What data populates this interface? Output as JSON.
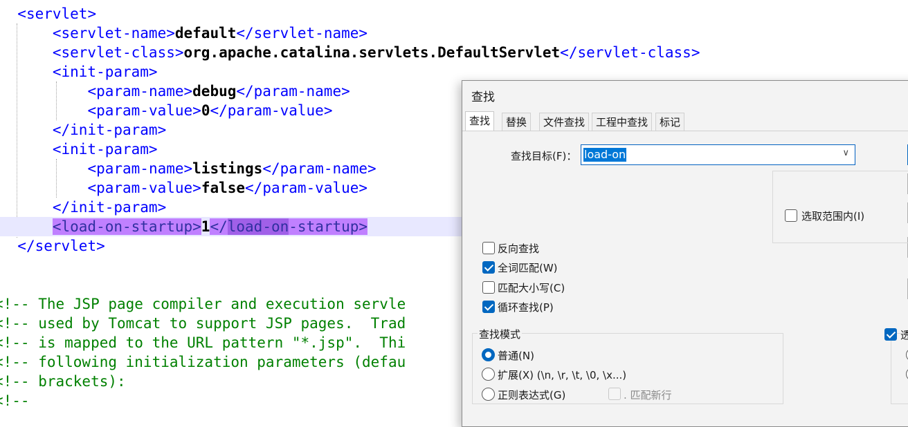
{
  "editor": {
    "lines": {
      "l0": {
        "open": "<servlet>"
      },
      "l1": {
        "open": "<servlet-name>",
        "value": "default",
        "close": "</servlet-name>"
      },
      "l2": {
        "open": "<servlet-class>",
        "value": "org.apache.catalina.servlets.DefaultServlet",
        "close": "</servlet-class>"
      },
      "l3": {
        "open": "<init-param>"
      },
      "l4": {
        "open": "<param-name>",
        "value": "debug",
        "close": "</param-name>"
      },
      "l5": {
        "open": "<param-value>",
        "value": "0",
        "close": "</param-value>"
      },
      "l6": {
        "close": "</init-param>"
      },
      "l7": {
        "open": "<init-param>"
      },
      "l8": {
        "open": "<param-name>",
        "value": "listings",
        "close": "</param-name>"
      },
      "l9": {
        "open": "<param-value>",
        "value": "false",
        "close": "</param-value>"
      },
      "l10": {
        "close": "</init-param>"
      },
      "l11": {
        "open": "<load-on-startup>",
        "value": "1",
        "close_a": "</",
        "close_b": "load-on",
        "close_c": "-startup>"
      },
      "l12": {
        "close": "</servlet>"
      },
      "c1": "<!-- The JSP page compiler and execution servle",
      "c2": "<!-- used by Tomcat to support JSP pages.  Trad",
      "c3": "<!-- is mapped to the URL pattern \"*.jsp\".  Thi",
      "c4": "<!-- following initialization parameters (defau",
      "c5": "<!-- brackets):",
      "c6": "<!--"
    }
  },
  "dialog": {
    "title": "查找",
    "tabs": [
      "查找",
      "替换",
      "文件查找",
      "工程中查找",
      "标记"
    ],
    "find_label": "查找目标(F)：",
    "find_value": "load-on",
    "in_selection_label": "选取范围内(I)",
    "options": {
      "backward": {
        "label": "反向查找",
        "checked": false
      },
      "whole_word": {
        "label": "全词匹配(W)",
        "checked": true
      },
      "match_case": {
        "label": "匹配大小写(C)",
        "checked": false
      },
      "wrap_around": {
        "label": "循环查找(P)",
        "checked": true
      }
    },
    "search_mode": {
      "title": "查找模式",
      "normal": "普通(N)",
      "extended": "扩展(X) (\\n, \\r, \\t, \\0, \\x...)",
      "regex": "正则表达式(G)",
      "dot_newline": ". 匹配新行",
      "selected": "normal"
    },
    "transparency_label": "透"
  },
  "colors": {
    "tag": "#0000ff",
    "comment": "#008000",
    "highlight": "#c080ff",
    "accent": "#0067c0"
  }
}
